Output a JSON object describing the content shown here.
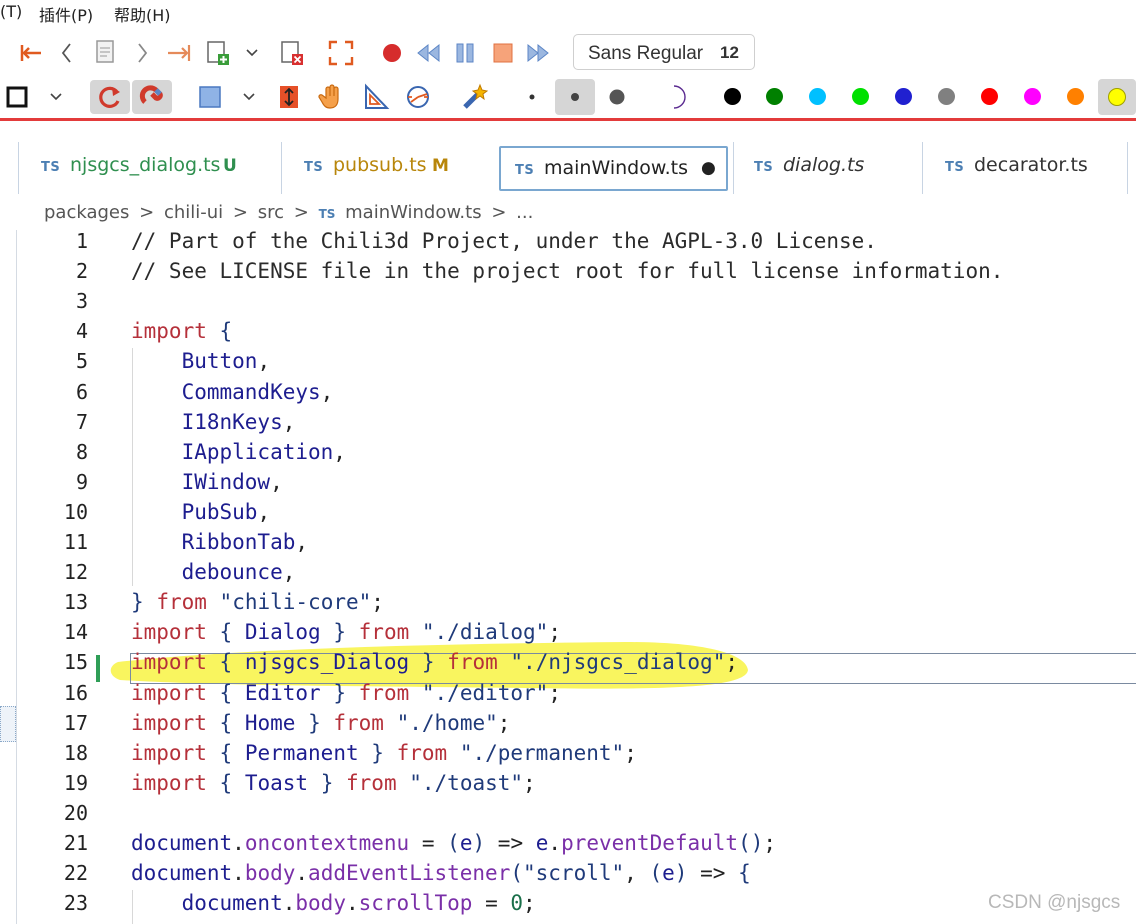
{
  "menubar": {
    "items": [
      "(T)",
      "插件(P)",
      "帮助(H)"
    ]
  },
  "toolbar": {
    "font_name": "Sans Regular",
    "font_size": "12",
    "palette": [
      "#000000",
      "#008000",
      "#00c0ff",
      "#00e000",
      "#2020d0",
      "#808080",
      "#ff0000",
      "#ff00ff",
      "#ff8000",
      "#ffff00"
    ],
    "accent": "#e33b3b"
  },
  "editor": {
    "tabs": [
      {
        "label": "njsgcs_dialog.ts",
        "badge": "U",
        "icon": "TS"
      },
      {
        "label": "pubsub.ts",
        "badge": "M",
        "icon": "TS"
      },
      {
        "label": "mainWindow.ts",
        "badge": "●",
        "icon": "TS"
      },
      {
        "label": "dialog.ts",
        "badge": "",
        "icon": "TS"
      },
      {
        "label": "decarator.ts",
        "badge": "",
        "icon": "TS"
      }
    ],
    "breadcrumb": [
      "packages",
      ">",
      "chili-ui",
      ">",
      "src",
      ">",
      "TS",
      "mainWindow.ts",
      ">",
      "..."
    ],
    "line_numbers": [
      "1",
      "2",
      "3",
      "4",
      "5",
      "6",
      "7",
      "8",
      "9",
      "10",
      "11",
      "12",
      "13",
      "14",
      "15",
      "16",
      "17",
      "18",
      "19",
      "20",
      "21",
      "22",
      "23"
    ],
    "lines": [
      "// Part of the Chili3d Project, under the AGPL-3.0 License.",
      "// See LICENSE file in the project root for full license information.",
      "",
      "import {",
      "    Button,",
      "    CommandKeys,",
      "    I18nKeys,",
      "    IApplication,",
      "    IWindow,",
      "    PubSub,",
      "    RibbonTab,",
      "    debounce,",
      "} from \"chili-core\";",
      "import { Dialog } from \"./dialog\";",
      "import { njsgcs_Dialog } from \"./njsgcs_dialog\";",
      "import { Editor } from \"./editor\";",
      "import { Home } from \"./home\";",
      "import { Permanent } from \"./permanent\";",
      "import { Toast } from \"./toast\";",
      "",
      "document.oncontextmenu = (e) => e.preventDefault();",
      "document.body.addEventListener(\"scroll\", (e) => {",
      "    document.body.scrollTop = 0;"
    ],
    "current_line": "15"
  },
  "watermark": "CSDN @njsgcs"
}
